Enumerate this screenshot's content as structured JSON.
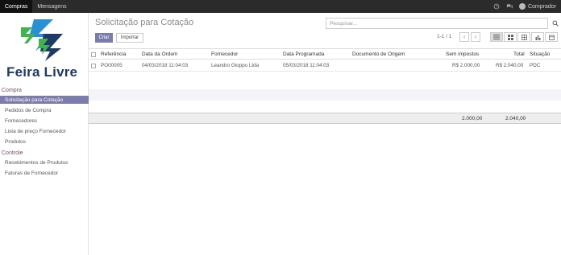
{
  "topbar": {
    "apps": [
      "Compras",
      "Mensagens"
    ],
    "user": "Comprador"
  },
  "sidebar": {
    "logo_text": "Feira Livre",
    "section1": "Compra",
    "items1": [
      "Solicitação para Cotação",
      "Pedidos de Compra",
      "Fornecedores",
      "Lista de preço Fornecedor",
      "Produtos"
    ],
    "section2": "Controle",
    "items2": [
      "Recebimentos de Produtos",
      "Faturas de Fornecedor"
    ]
  },
  "main": {
    "title": "Solicitação para Cotação",
    "search_placeholder": "Pesquisar...",
    "create_label": "Criar",
    "import_label": "Importar",
    "pager": "1-1 / 1",
    "columns": [
      "Referência",
      "Data da Ordem",
      "Fornecedor",
      "Data Programada",
      "Documento de Origem",
      "Sem impostos",
      "Total",
      "Situação"
    ],
    "rows": [
      {
        "ref": "PO00005",
        "order_date": "04/03/2018 11:04:03",
        "supplier": "Leandro Gioppo Ltda",
        "scheduled": "05/03/2018 11:04:03",
        "origin": "",
        "untaxed": "R$ 2.000,00",
        "total": "R$ 2.040,00",
        "status": "PDC"
      }
    ],
    "totals": {
      "untaxed": "2.000,00",
      "total": "2.040,00"
    }
  },
  "colors": {
    "accent": "#7c7bad",
    "topbar": "#2b2b2b",
    "logo_blue": "#1f3a68",
    "logo_green": "#3fb44b",
    "logo_lightblue": "#2b8fd6"
  }
}
